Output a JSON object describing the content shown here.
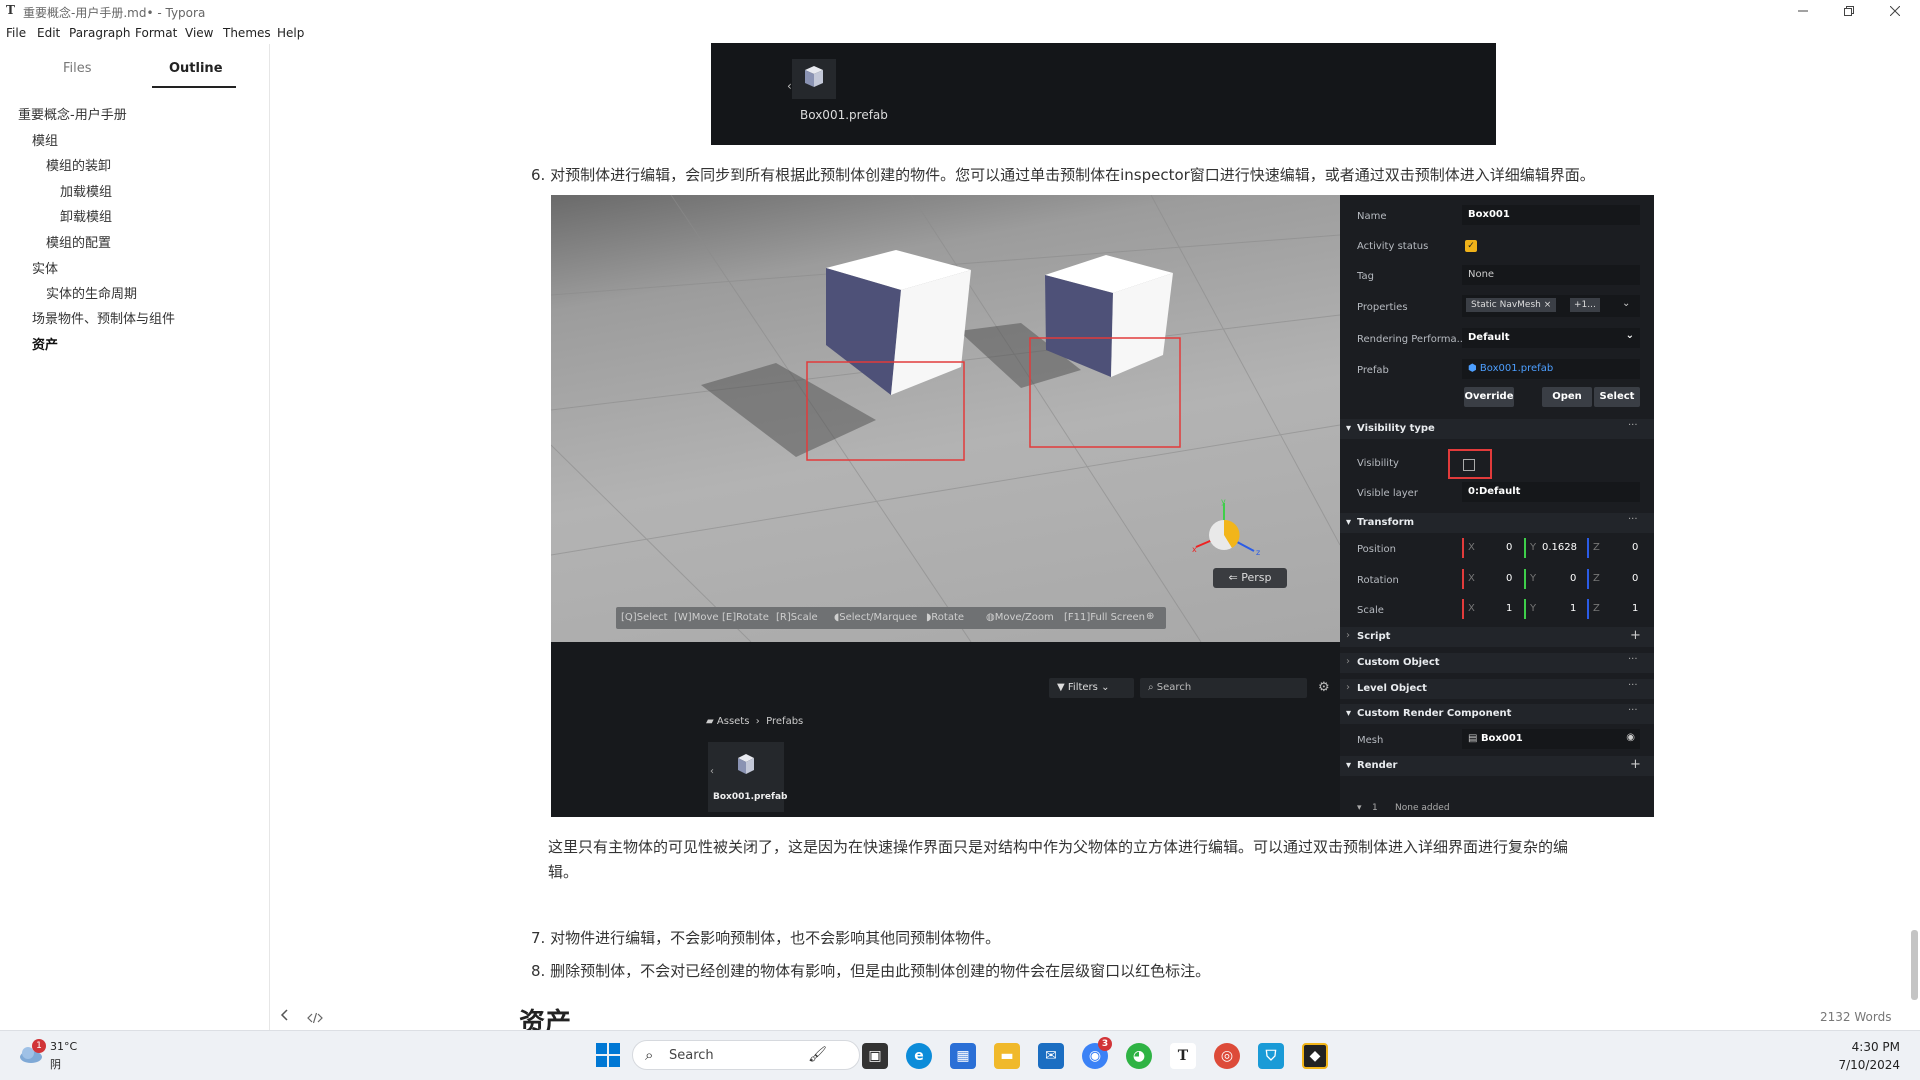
{
  "window": {
    "app_icon": "T",
    "title": "重要概念-用户手册.md• - Typora",
    "controls": [
      "minimize",
      "maximize",
      "close"
    ]
  },
  "menu": [
    "File",
    "Edit",
    "Paragraph",
    "Format",
    "View",
    "Themes",
    "Help"
  ],
  "sidebar": {
    "tabs": [
      "Files",
      "Outline"
    ],
    "active_tab": "Outline",
    "outline": [
      {
        "label": "重要概念-用户手册",
        "level": 0
      },
      {
        "label": "模组",
        "level": 1
      },
      {
        "label": "模组的装卸",
        "level": 2
      },
      {
        "label": "加载模组",
        "level": 3
      },
      {
        "label": "卸载模组",
        "level": 3
      },
      {
        "label": "模组的配置",
        "level": 2
      },
      {
        "label": "实体",
        "level": 1
      },
      {
        "label": "实体的生命周期",
        "level": 2
      },
      {
        "label": "场景物件、预制体与组件",
        "level": 1
      },
      {
        "label": "资产",
        "level": 1,
        "active": true
      }
    ]
  },
  "content": {
    "top_image": {
      "file_label": "Box001.prefab"
    },
    "item6": "6. 对预制体进行编辑，会同步到所有根据此预制体创建的物件。您可以通过单击预制体在inspector窗口进行快速编辑，或者通过双击预制体进入详细编辑界面。",
    "editor_shot": {
      "toolbar": [
        "Select",
        "Move",
        "Rotate",
        "Scale",
        "Select/Marquee",
        "Rotate",
        "Move/Zoom",
        "Full Screen"
      ],
      "toolbar_keys": [
        "Q",
        "W",
        "E",
        "R",
        "",
        "",
        "",
        "F11"
      ],
      "persp": "Persp",
      "gizmo_axes": [
        "x",
        "y",
        "z"
      ],
      "filters": "Filters",
      "search": "Search",
      "breadcrumb": [
        "Assets",
        "Prefabs"
      ],
      "asset_label": "Box001.prefab",
      "inspector": {
        "name_label": "Name",
        "name_value": "Box001",
        "activity_label": "Activity status",
        "tag_label": "Tag",
        "tag_value": "None",
        "properties_label": "Properties",
        "properties_chip": "Static NavMesh",
        "properties_more": "+1...",
        "render_perf_label": "Rendering Performa...",
        "render_perf_value": "Default",
        "prefab_label": "Prefab",
        "prefab_value": "Box001.prefab",
        "btn_override": "Override",
        "btn_open": "Open",
        "btn_select": "Select",
        "visibility_type": "Visibility type",
        "visibility_label": "Visibility",
        "visible_layer_label": "Visible layer",
        "visible_layer_value": "0:Default",
        "transform": "Transform",
        "position_label": "Position",
        "position": [
          "0",
          "0.1628",
          "0"
        ],
        "rotation_label": "Rotation",
        "rotation": [
          "0",
          "0",
          "0"
        ],
        "scale_label": "Scale",
        "scale": [
          "1",
          "1",
          "1"
        ],
        "axis_x": "X",
        "axis_y": "Y",
        "axis_z": "Z",
        "script": "Script",
        "custom_object": "Custom Object",
        "level_object": "Level Object",
        "custom_render": "Custom Render Component",
        "mesh_label": "Mesh",
        "mesh_value": "Box001",
        "render": "Render",
        "render_row_num": "1",
        "render_row_text": "None added"
      }
    },
    "caption_line1": "这里只有主物体的可见性被关闭了，这是因为在快速操作界面只是对结构中作为父物体的立方体进行编辑。可以通过双击预制体进入详细界面进行复杂的编",
    "caption_line2": "辑。",
    "item7": "7. 对物件进行编辑，不会影响预制体，也不会影响其他同预制体物件。",
    "item8": "8. 删除预制体，不会对已经创建的物体有影响，但是由此预制体创建的物件会在层级窗口以红色标注。",
    "heading_assets": "资产"
  },
  "status": {
    "word_count": "2132 Words"
  },
  "taskbar": {
    "weather_badge": "1",
    "weather_temp": "31°C",
    "weather_cond": "阴",
    "search_placeholder": "Search",
    "chat_badge": "3",
    "time": "4:30 PM",
    "date": "7/10/2024",
    "colors": {
      "windows": "#0078d4",
      "edge": "#0c8cd9",
      "chrome": "#dd4b39",
      "typora": "#222222"
    }
  }
}
